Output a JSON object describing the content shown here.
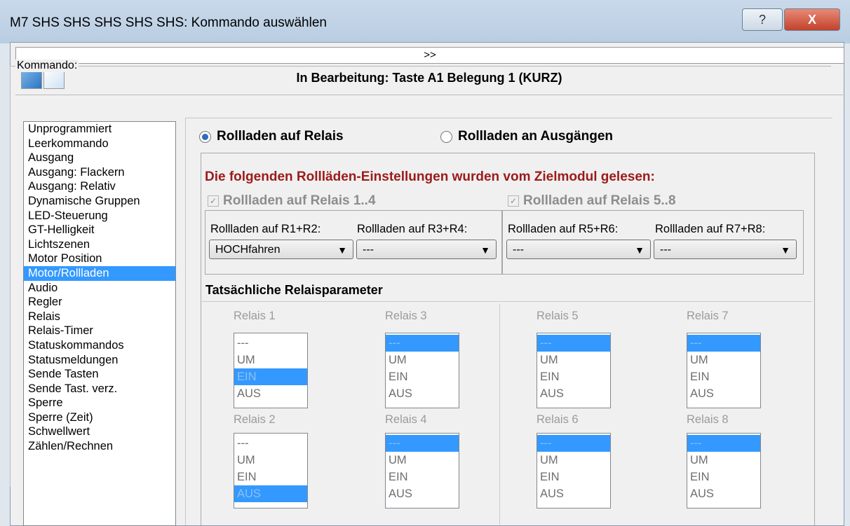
{
  "window": {
    "title": "M7 SHS SHS SHS SHS SHS: Kommando auswählen"
  },
  "titlebar": {
    "help_label": "?",
    "close_label": "X"
  },
  "expand_bar": {
    "label": ">>"
  },
  "toolbar": {
    "editing_label": "In Bearbeitung: Taste A1 Belegung 1 (KURZ)",
    "icon_a": "server-icon",
    "icon_b": "edit-icon"
  },
  "kommando": {
    "group_label": "Kommando:",
    "items": [
      "Unprogrammiert",
      "Leerkommando",
      "Ausgang",
      "Ausgang: Flackern",
      "Ausgang: Relativ",
      "Dynamische Gruppen",
      "LED-Steuerung",
      "GT-Helligkeit",
      "Lichtszenen",
      "Motor Position",
      "Motor/Rollladen",
      "Audio",
      "Regler",
      "Relais",
      "Relais-Timer",
      "Statuskommandos",
      "Statusmeldungen",
      "Sende Tasten",
      "Sende Tast. verz.",
      "Sperre",
      "Sperre (Zeit)",
      "Schwellwert",
      "Zählen/Rechnen"
    ],
    "selected": "Motor/Rollladen"
  },
  "mode": {
    "relais_label": "Rollladen auf Relais",
    "ausgaenge_label": "Rollladen an Ausgängen",
    "selected": "relais"
  },
  "settings": {
    "heading": "Die folgenden Rollläden-Einstellungen wurden vom Zielmodul gelesen:",
    "check_1_4": "Rollladen auf Relais 1..4",
    "check_5_8": "Rollladen auf Relais 5..8",
    "check_mark": "✓",
    "pairs": [
      {
        "label": "Rollladen auf R1+R2:",
        "value": "HOCHfahren"
      },
      {
        "label": "Rollladen auf R3+R4:",
        "value": "---"
      },
      {
        "label": "Rollladen auf R5+R6:",
        "value": "---"
      },
      {
        "label": "Rollladen auf R7+R8:",
        "value": "---"
      }
    ],
    "arrow": "▼"
  },
  "relais_params": {
    "heading": "Tatsächliche Relaisparameter",
    "options": [
      "---",
      "UM",
      "EIN",
      "AUS"
    ],
    "relais": [
      {
        "label": "Relais 1",
        "selected": "EIN"
      },
      {
        "label": "Relais 2",
        "selected": "AUS"
      },
      {
        "label": "Relais 3",
        "selected": "---"
      },
      {
        "label": "Relais 4",
        "selected": "---"
      },
      {
        "label": "Relais 5",
        "selected": "---"
      },
      {
        "label": "Relais 6",
        "selected": "---"
      },
      {
        "label": "Relais 7",
        "selected": "---"
      },
      {
        "label": "Relais 8",
        "selected": "---"
      }
    ]
  }
}
